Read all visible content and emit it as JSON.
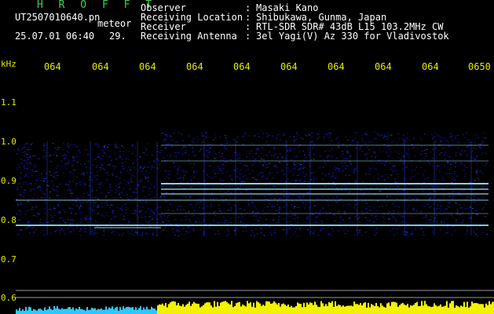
{
  "header": {
    "brand": "H R O F F T",
    "filename": "UT2507010640.pn",
    "detection_type": "meteor",
    "datetime": "25.07.01 06:40",
    "count": "29.",
    "info": [
      {
        "label": "Observer",
        "value": "Masaki Kano"
      },
      {
        "label": "Receiving Location",
        "value": "Shibukawa, Gunma, Japan"
      },
      {
        "label": "Receiver",
        "value": "RTL-SDR SDR# 43dB L15 103.2MHz CW"
      },
      {
        "label": "Receiving Antenna",
        "value": "3el Yagi(V) Az 330 for Vladivostok"
      }
    ]
  },
  "axes": {
    "freq_unit": "kHz",
    "time_ticks": [
      "064",
      "064",
      "064",
      "064",
      "064",
      "064",
      "064",
      "064",
      "064",
      "0650"
    ],
    "freq_ticks": [
      "1.1",
      "1.0",
      "0.9",
      "0.8",
      "0.7",
      "0.6"
    ]
  },
  "colors": {
    "text_white": "#ffffff",
    "brand_green": "#3fd24a",
    "tick_yellow": "#e8e800",
    "echo_line": "#9fe9ff",
    "noise_blue": "#1a2cff",
    "level_cyan": "#2ec8ff",
    "level_yellow": "#f2f200"
  }
}
